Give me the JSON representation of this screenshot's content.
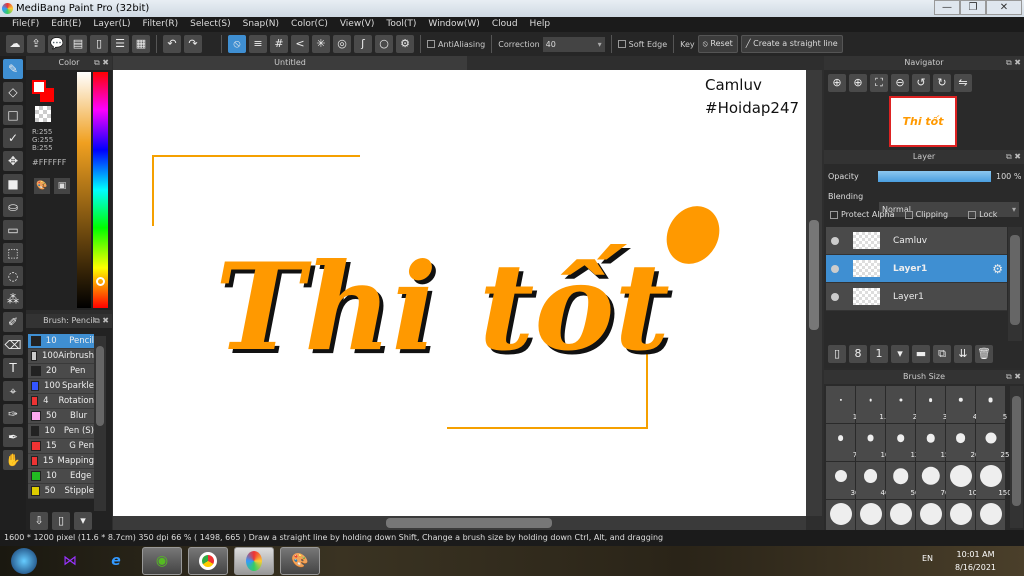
{
  "window": {
    "title": "MediBang Paint Pro (32bit)",
    "minimize": "—",
    "restore": "❐",
    "close": "✕"
  },
  "menu": [
    "File(F)",
    "Edit(E)",
    "Layer(L)",
    "Filter(R)",
    "Select(S)",
    "Snap(N)",
    "Color(C)",
    "View(V)",
    "Tool(T)",
    "Window(W)",
    "Cloud",
    "Help"
  ],
  "toolbar": {
    "antialiasing_label": "AntiAliasing",
    "correction_label": "Correction",
    "correction_value": "40",
    "soft_edge_label": "Soft Edge",
    "key_label": "Key",
    "reset_label": "Reset",
    "straight_line_label": "Create a straight line"
  },
  "color_panel": {
    "title": "Color",
    "r": "R:255",
    "g": "G:255",
    "b": "B:255",
    "hex": "#FFFFFF",
    "primary_color": "#FFFFFF",
    "secondary_color": "#FF0000"
  },
  "brush_panel": {
    "title": "Brush: Pencil",
    "items": [
      {
        "size": "10",
        "name": "Pencil",
        "color": "#222222",
        "selected": true
      },
      {
        "size": "100",
        "name": "Airbrush",
        "color": "#cccccc"
      },
      {
        "size": "20",
        "name": "Pen",
        "color": "#222222"
      },
      {
        "size": "100",
        "name": "Sparkle",
        "color": "#3355ff"
      },
      {
        "size": "4",
        "name": "Rotation",
        "color": "#ee3333"
      },
      {
        "size": "50",
        "name": "Blur",
        "color": "#ffaaee"
      },
      {
        "size": "10",
        "name": "Pen (S)",
        "color": "#222222"
      },
      {
        "size": "15",
        "name": "G Pen",
        "color": "#ee3333"
      },
      {
        "size": "15",
        "name": "Mapping",
        "color": "#ee3333"
      },
      {
        "size": "10",
        "name": "Edge",
        "color": "#22bb22"
      },
      {
        "size": "50",
        "name": "Stipple",
        "color": "#ddcc00"
      }
    ]
  },
  "document": {
    "tab": "Untitled"
  },
  "canvas": {
    "watermark_line1": "Camluv",
    "watermark_line2": "#Hoidap247",
    "lettering": "Thi tốt",
    "lettering_color": "#FF9900"
  },
  "navigator": {
    "title": "Navigator"
  },
  "layer_panel": {
    "title": "Layer",
    "opacity_label": "Opacity",
    "opacity_value": "100 %",
    "opacity": 100,
    "blending_label": "Blending",
    "blending_value": "Normal",
    "protect_alpha": "Protect Alpha",
    "clipping": "Clipping",
    "lock": "Lock",
    "layers": [
      {
        "name": "Camluv",
        "selected": false
      },
      {
        "name": "Layer1",
        "selected": true
      },
      {
        "name": "Layer1",
        "selected": false
      }
    ]
  },
  "brush_size_panel": {
    "title": "Brush Size",
    "sizes": [
      "1",
      "1.5",
      "2",
      "3",
      "4",
      "5",
      "7",
      "10",
      "12",
      "15",
      "20",
      "25",
      "30",
      "40",
      "50",
      "70",
      "100",
      "150"
    ]
  },
  "status": {
    "text": "1600 * 1200 pixel   (11.6 * 8.7cm)   350 dpi   66 %   ( 1498, 665 )   Draw a straight line by holding down Shift, Change a brush size by holding down Ctrl, Alt, and dragging"
  },
  "taskbar": {
    "lang": "EN",
    "time": "10:01 AM",
    "date": "8/16/2021"
  }
}
